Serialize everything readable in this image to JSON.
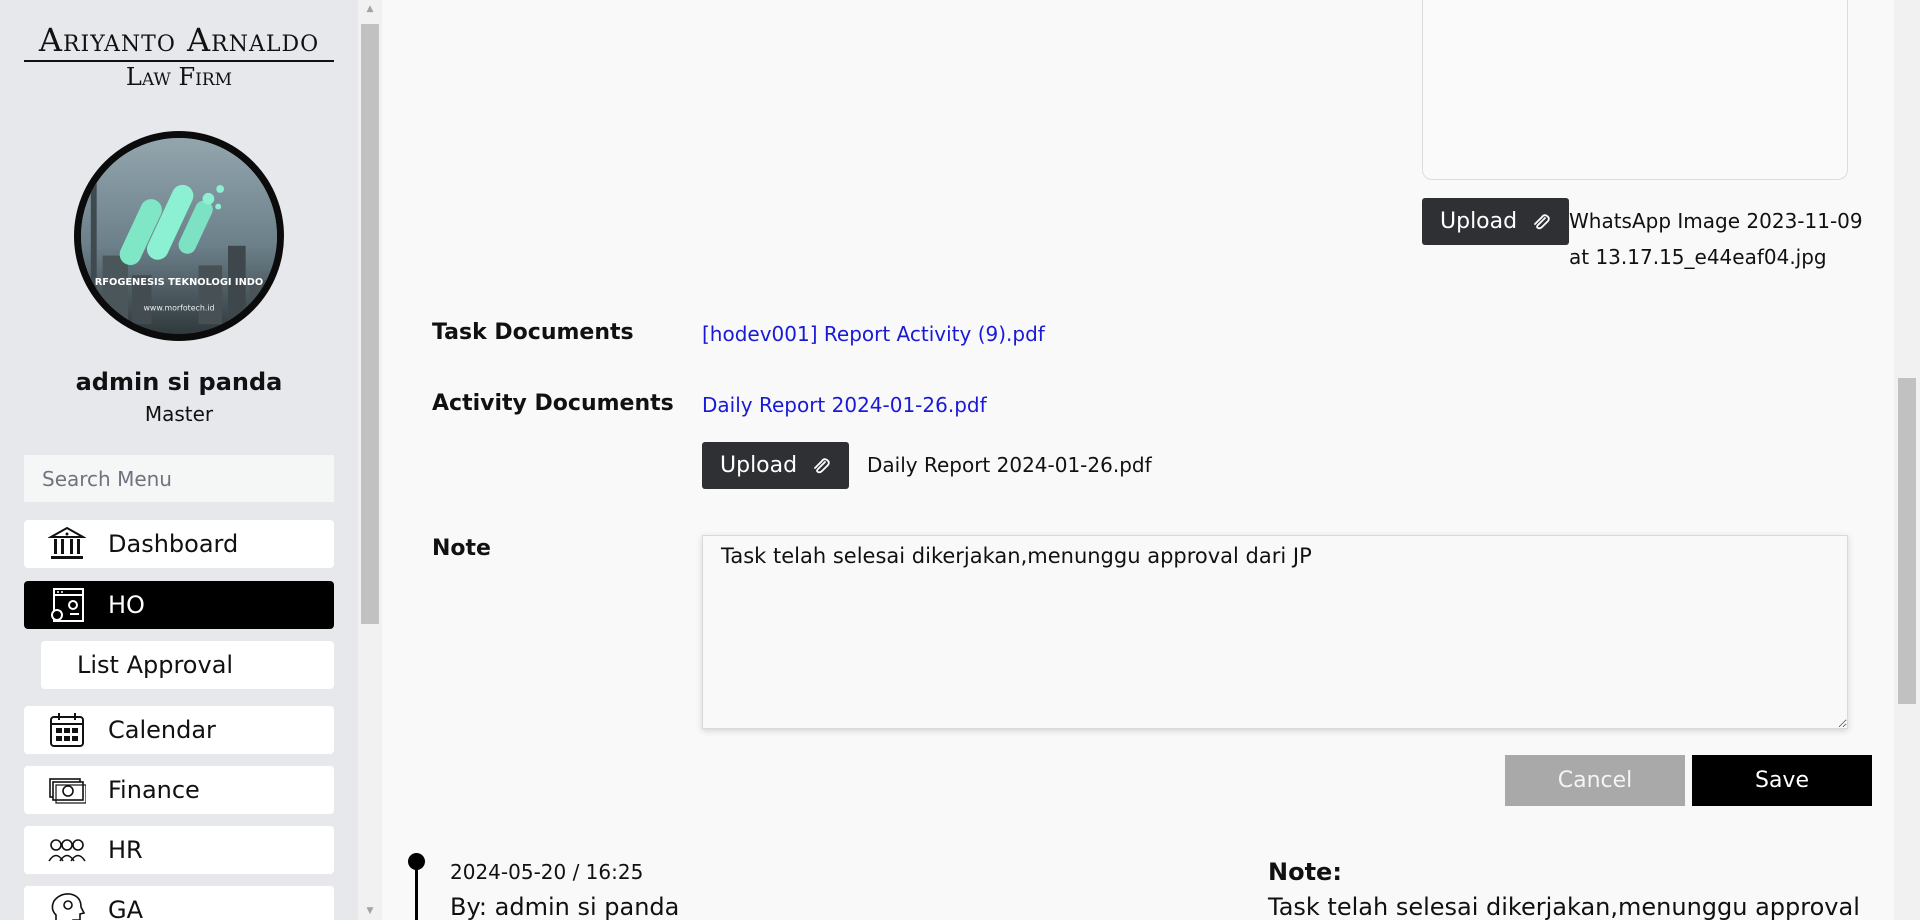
{
  "brand": {
    "name_line1": "Ariyanto Arnaldo",
    "name_line2": "Law Firm",
    "avatar_text": "RFOGENESIS TEKNOLOGI INDO",
    "avatar_url_text": "www.morfotech.id"
  },
  "user": {
    "name": "admin si panda",
    "role": "Master"
  },
  "search": {
    "placeholder": "Search Menu"
  },
  "menu": {
    "dashboard": "Dashboard",
    "ho": "HO",
    "list_approval": "List Approval",
    "calendar": "Calendar",
    "finance": "Finance",
    "hr": "HR",
    "ga": "GA"
  },
  "attachment": {
    "upload_label": "Upload",
    "file_name_line1": "WhatsApp Image 2023-11-09",
    "file_name_line2": "at 13.17.15_e44eaf04.jpg"
  },
  "task_documents": {
    "label": "Task Documents",
    "link": "[hodev001] Report Activity (9).pdf"
  },
  "activity_documents": {
    "label": "Activity Documents",
    "link": "Daily Report 2024-01-26.pdf",
    "upload_label": "Upload",
    "file_name": "Daily Report 2024-01-26.pdf"
  },
  "note": {
    "label": "Note",
    "value": "Task telah selesai dikerjakan,menunggu approval dari JP"
  },
  "actions": {
    "cancel": "Cancel",
    "save": "Save"
  },
  "timeline": {
    "date": "2024-05-20 / 16:25",
    "by": "By: admin si panda",
    "note_label": "Note:",
    "note_text": "Task telah selesai dikerjakan,menunggu approval"
  },
  "colors": {
    "link": "#1a1ad6",
    "sidebar_bg": "#e7e8ec",
    "active_menu": "#000000",
    "cancel_button": "#a9a9a9"
  }
}
